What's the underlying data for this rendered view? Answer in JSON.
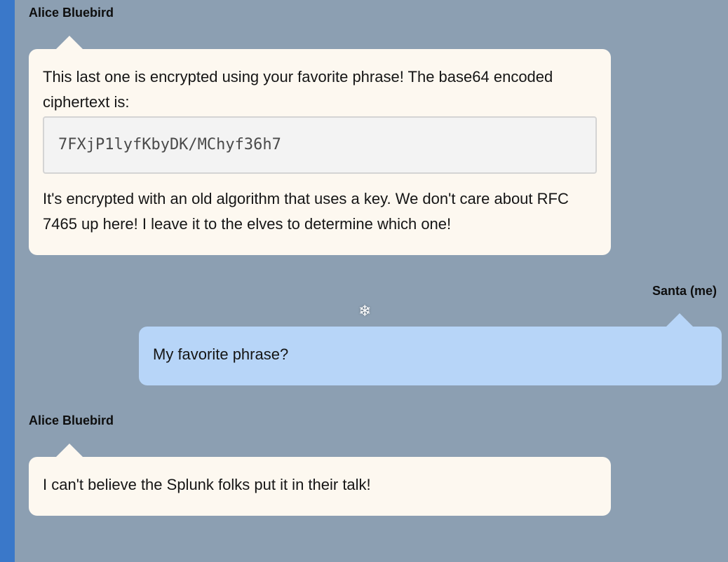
{
  "conversation": {
    "messages": [
      {
        "sender": "Alice Bluebird",
        "paragraph1": "This last one is encrypted using your favorite phrase! The base64 encoded ciphertext is:",
        "code": "7FXjP1lyfKbyDK/MChyf36h7",
        "paragraph2": "It's encrypted with an old algorithm that uses a key. We don't care about RFC 7465 up here! I leave it to the elves to determine which one!"
      },
      {
        "sender": "Santa (me)",
        "text": "My favorite phrase?"
      },
      {
        "sender": "Alice Bluebird",
        "text": "I can't believe the Splunk folks put it in their talk!"
      }
    ]
  },
  "decoration": {
    "snowflake_glyph": "❄",
    "snowflake_icon": "snowflake-icon",
    "sidebar_color": "#3a78c9",
    "background_color": "#8c9fb2",
    "alice_bubble_color": "#fdf8f0",
    "me_bubble_color": "#b7d5f8"
  }
}
